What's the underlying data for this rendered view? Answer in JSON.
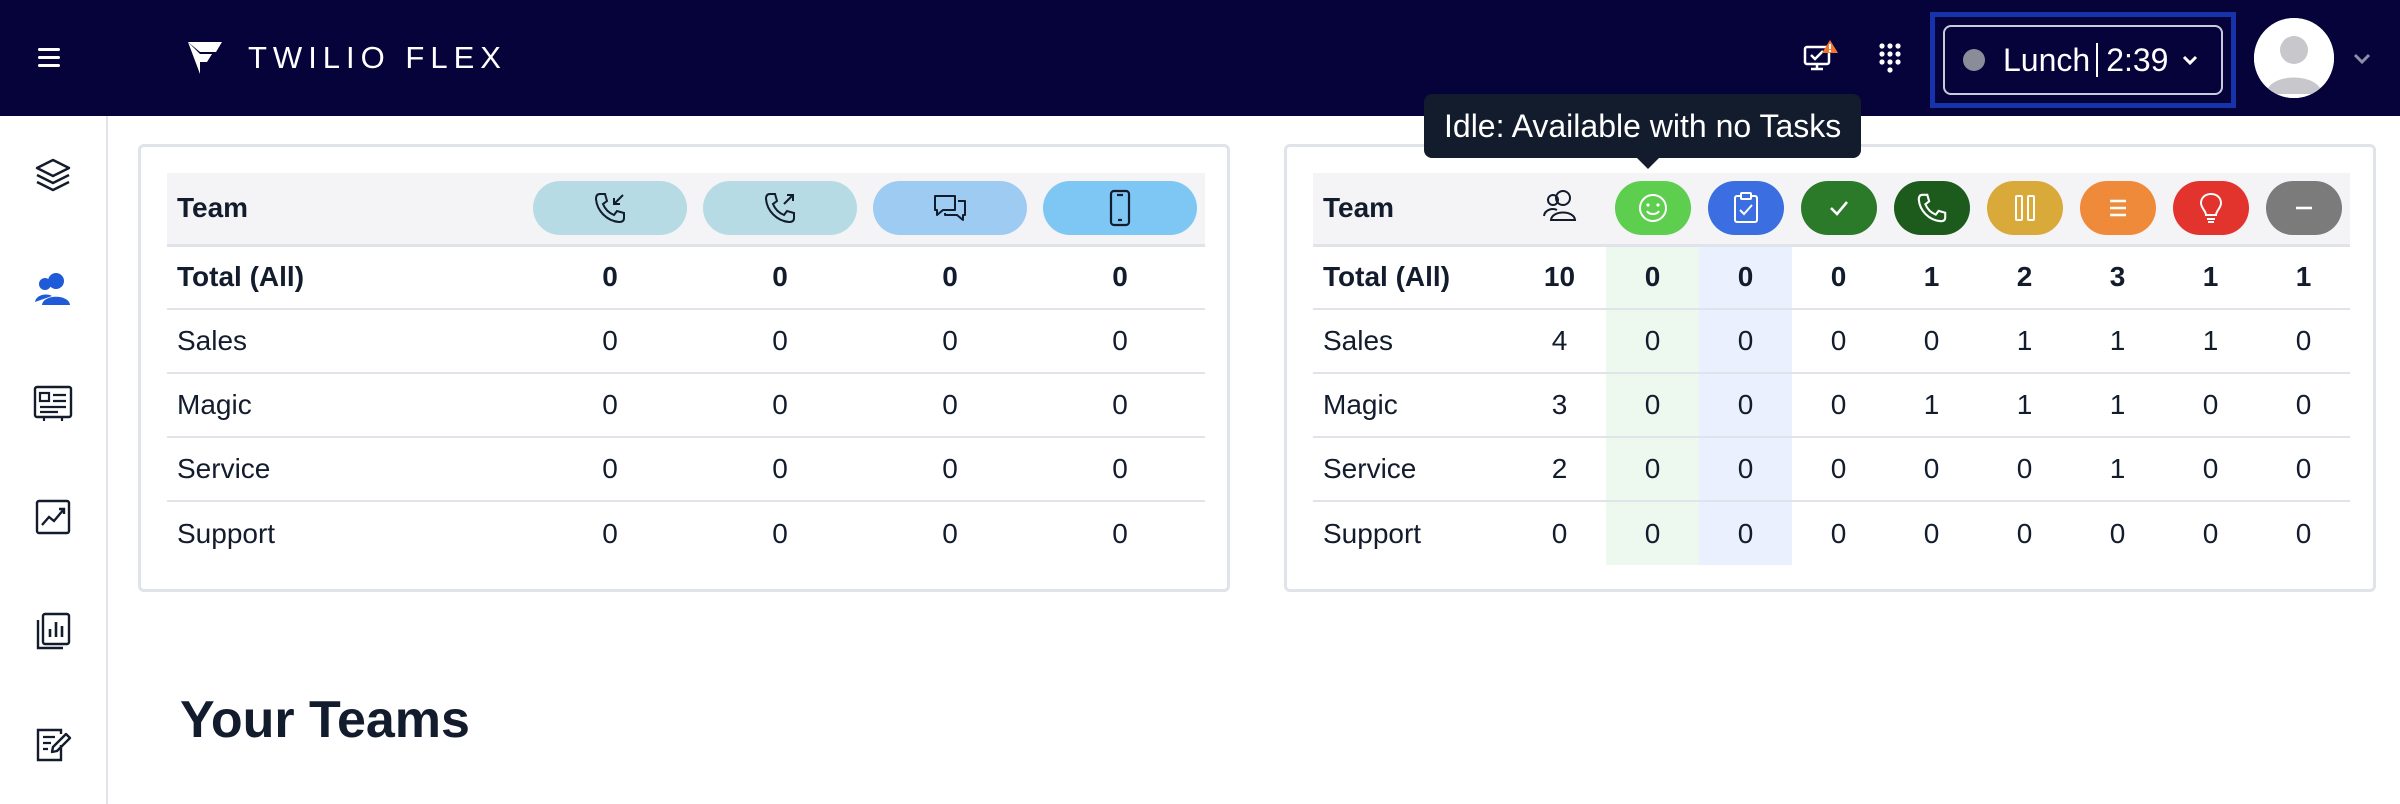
{
  "header": {
    "brand": "TWILIO FLEX",
    "status": {
      "activity": "Lunch",
      "timer": "2:39"
    }
  },
  "sidenav": {
    "items": [
      {
        "name": "layers-icon"
      },
      {
        "name": "agents-icon"
      },
      {
        "name": "profile-card-icon"
      },
      {
        "name": "analytics-icon"
      },
      {
        "name": "reports-icon"
      },
      {
        "name": "edit-form-icon"
      }
    ]
  },
  "tooltip": "Idle: Available with no Tasks",
  "tasks_table": {
    "team_header": "Team",
    "columns": [
      "incoming-call-icon",
      "outgoing-call-icon",
      "chat-icon",
      "mobile-icon"
    ],
    "rows": [
      {
        "team": "Total (All)",
        "values": [
          "0",
          "0",
          "0",
          "0"
        ]
      },
      {
        "team": "Sales",
        "values": [
          "0",
          "0",
          "0",
          "0"
        ]
      },
      {
        "team": "Magic",
        "values": [
          "0",
          "0",
          "0",
          "0"
        ]
      },
      {
        "team": "Service",
        "values": [
          "0",
          "0",
          "0",
          "0"
        ]
      },
      {
        "team": "Support",
        "values": [
          "0",
          "0",
          "0",
          "0"
        ]
      }
    ]
  },
  "agents_table": {
    "team_header": "Team",
    "columns": [
      {
        "icon": "agents-icon",
        "color": "#ffffff"
      },
      {
        "icon": "smiley-icon",
        "color": "#5ece4f"
      },
      {
        "icon": "clipboard-check-icon",
        "color": "#3b6ee0"
      },
      {
        "icon": "check-icon",
        "color": "#2a7a2a"
      },
      {
        "icon": "phone-icon",
        "color": "#1d5b1d"
      },
      {
        "icon": "pause-icon",
        "color": "#d9a93a"
      },
      {
        "icon": "menu-lines-icon",
        "color": "#ef8a3a"
      },
      {
        "icon": "lightbulb-icon",
        "color": "#e3332d"
      },
      {
        "icon": "minus-icon",
        "color": "#7b7b7b"
      }
    ],
    "rows": [
      {
        "team": "Total (All)",
        "values": [
          "10",
          "0",
          "0",
          "0",
          "1",
          "2",
          "3",
          "1",
          "1"
        ]
      },
      {
        "team": "Sales",
        "values": [
          "4",
          "0",
          "0",
          "0",
          "0",
          "1",
          "1",
          "1",
          "0"
        ]
      },
      {
        "team": "Magic",
        "values": [
          "3",
          "0",
          "0",
          "0",
          "1",
          "1",
          "1",
          "0",
          "0"
        ]
      },
      {
        "team": "Service",
        "values": [
          "2",
          "0",
          "0",
          "0",
          "0",
          "0",
          "1",
          "0",
          "0"
        ]
      },
      {
        "team": "Support",
        "values": [
          "0",
          "0",
          "0",
          "0",
          "0",
          "0",
          "0",
          "0",
          "0"
        ]
      }
    ]
  },
  "section": {
    "title": "Your Teams"
  }
}
